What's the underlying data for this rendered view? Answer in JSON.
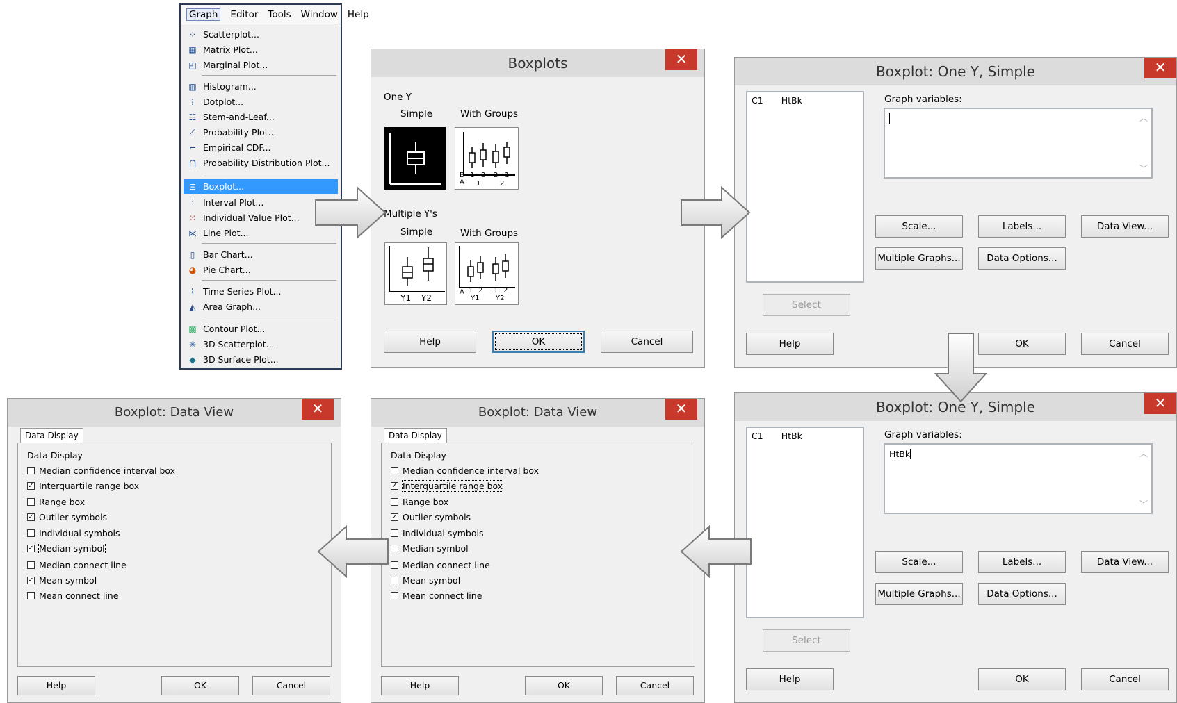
{
  "menu": {
    "bar": [
      "Graph",
      "Editor",
      "Tools",
      "Window",
      "Help"
    ],
    "items": [
      {
        "label": "Scatterplot...",
        "icon": "scatterplot-icon"
      },
      {
        "label": "Matrix Plot...",
        "icon": "matrix-plot-icon"
      },
      {
        "label": "Marginal Plot...",
        "icon": "marginal-plot-icon"
      },
      {
        "label": "Histogram...",
        "icon": "histogram-icon"
      },
      {
        "label": "Dotplot...",
        "icon": "dotplot-icon"
      },
      {
        "label": "Stem-and-Leaf...",
        "icon": "stem-and-leaf-icon"
      },
      {
        "label": "Probability Plot...",
        "icon": "probability-plot-icon"
      },
      {
        "label": "Empirical CDF...",
        "icon": "empirical-cdf-icon"
      },
      {
        "label": "Probability Distribution Plot...",
        "icon": "distribution-curve-icon"
      },
      {
        "label": "Boxplot...",
        "icon": "boxplot-icon",
        "selected": true
      },
      {
        "label": "Interval Plot...",
        "icon": "interval-plot-icon"
      },
      {
        "label": "Individual Value Plot...",
        "icon": "individual-value-icon"
      },
      {
        "label": "Line Plot...",
        "icon": "line-plot-icon"
      },
      {
        "label": "Bar Chart...",
        "icon": "bar-chart-icon"
      },
      {
        "label": "Pie Chart...",
        "icon": "pie-chart-icon"
      },
      {
        "label": "Time Series Plot...",
        "icon": "time-series-icon"
      },
      {
        "label": "Area Graph...",
        "icon": "area-graph-icon"
      },
      {
        "label": "Contour Plot...",
        "icon": "contour-plot-icon"
      },
      {
        "label": "3D Scatterplot...",
        "icon": "3d-scatter-icon"
      },
      {
        "label": "3D Surface Plot...",
        "icon": "3d-surface-icon"
      }
    ]
  },
  "boxplots": {
    "title": "Boxplots",
    "close": "✕",
    "one_y": "One Y",
    "multiple_y": "Multiple Y's",
    "simple": "Simple",
    "with_groups": "With Groups",
    "ticks_one_groups": [
      "B",
      "A",
      "1",
      "2",
      "1",
      "2",
      "1",
      "2"
    ],
    "ticks_multi_simple": [
      "Y1",
      "Y2"
    ],
    "ticks_multi_groups": [
      "A",
      "1",
      "2",
      "1",
      "2",
      "Y1",
      "Y2"
    ],
    "help": "Help",
    "ok": "OK",
    "cancel": "Cancel"
  },
  "onesimple_a": {
    "title": "Boxplot: One Y, Simple",
    "close": "✕",
    "list_col": "C1",
    "list_name": "HtBk",
    "graph_vars_label": "Graph variables:",
    "graph_vars_value": "",
    "scale": "Scale...",
    "labels": "Labels...",
    "data_view": "Data View...",
    "multiple_graphs": "Multiple Graphs...",
    "data_options": "Data Options...",
    "select": "Select",
    "help": "Help",
    "ok": "OK",
    "cancel": "Cancel"
  },
  "onesimple_b": {
    "title": "Boxplot: One Y, Simple",
    "close": "✕",
    "list_col": "C1",
    "list_name": "HtBk",
    "graph_vars_label": "Graph variables:",
    "graph_vars_value": "HtBk",
    "scale": "Scale...",
    "labels": "Labels...",
    "data_view": "Data View...",
    "multiple_graphs": "Multiple Graphs...",
    "data_options": "Data Options...",
    "select": "Select",
    "help": "Help",
    "ok": "OK",
    "cancel": "Cancel"
  },
  "dataview_default": {
    "title": "Boxplot: Data View",
    "close": "✕",
    "tab": "Data Display",
    "section": "Data Display",
    "options": [
      {
        "label": "Median confidence interval box",
        "checked": false
      },
      {
        "label": "Interquartile range box",
        "checked": true,
        "focus": true
      },
      {
        "label": "Range box",
        "checked": false
      },
      {
        "label": "Outlier symbols",
        "checked": true
      },
      {
        "label": "Individual symbols",
        "checked": false
      },
      {
        "label": "Median symbol",
        "checked": false
      },
      {
        "label": "Median connect line",
        "checked": false
      },
      {
        "label": "Mean symbol",
        "checked": false
      },
      {
        "label": "Mean connect line",
        "checked": false
      }
    ],
    "help": "Help",
    "ok": "OK",
    "cancel": "Cancel"
  },
  "dataview_modified": {
    "title": "Boxplot: Data View",
    "close": "✕",
    "tab": "Data Display",
    "section": "Data Display",
    "options": [
      {
        "label": "Median confidence interval box",
        "checked": false
      },
      {
        "label": "Interquartile range box",
        "checked": true
      },
      {
        "label": "Range box",
        "checked": false
      },
      {
        "label": "Outlier symbols",
        "checked": true
      },
      {
        "label": "Individual symbols",
        "checked": false
      },
      {
        "label": "Median symbol",
        "checked": true,
        "focus": true
      },
      {
        "label": "Median connect line",
        "checked": false
      },
      {
        "label": "Mean symbol",
        "checked": true
      },
      {
        "label": "Mean connect line",
        "checked": false
      }
    ],
    "help": "Help",
    "ok": "OK",
    "cancel": "Cancel"
  },
  "colors": {
    "close_red": "#c9392b",
    "menu_highlight": "#3399ff",
    "dialog_bg": "#f0f0f0",
    "titlebar": "#dcdcdc"
  }
}
